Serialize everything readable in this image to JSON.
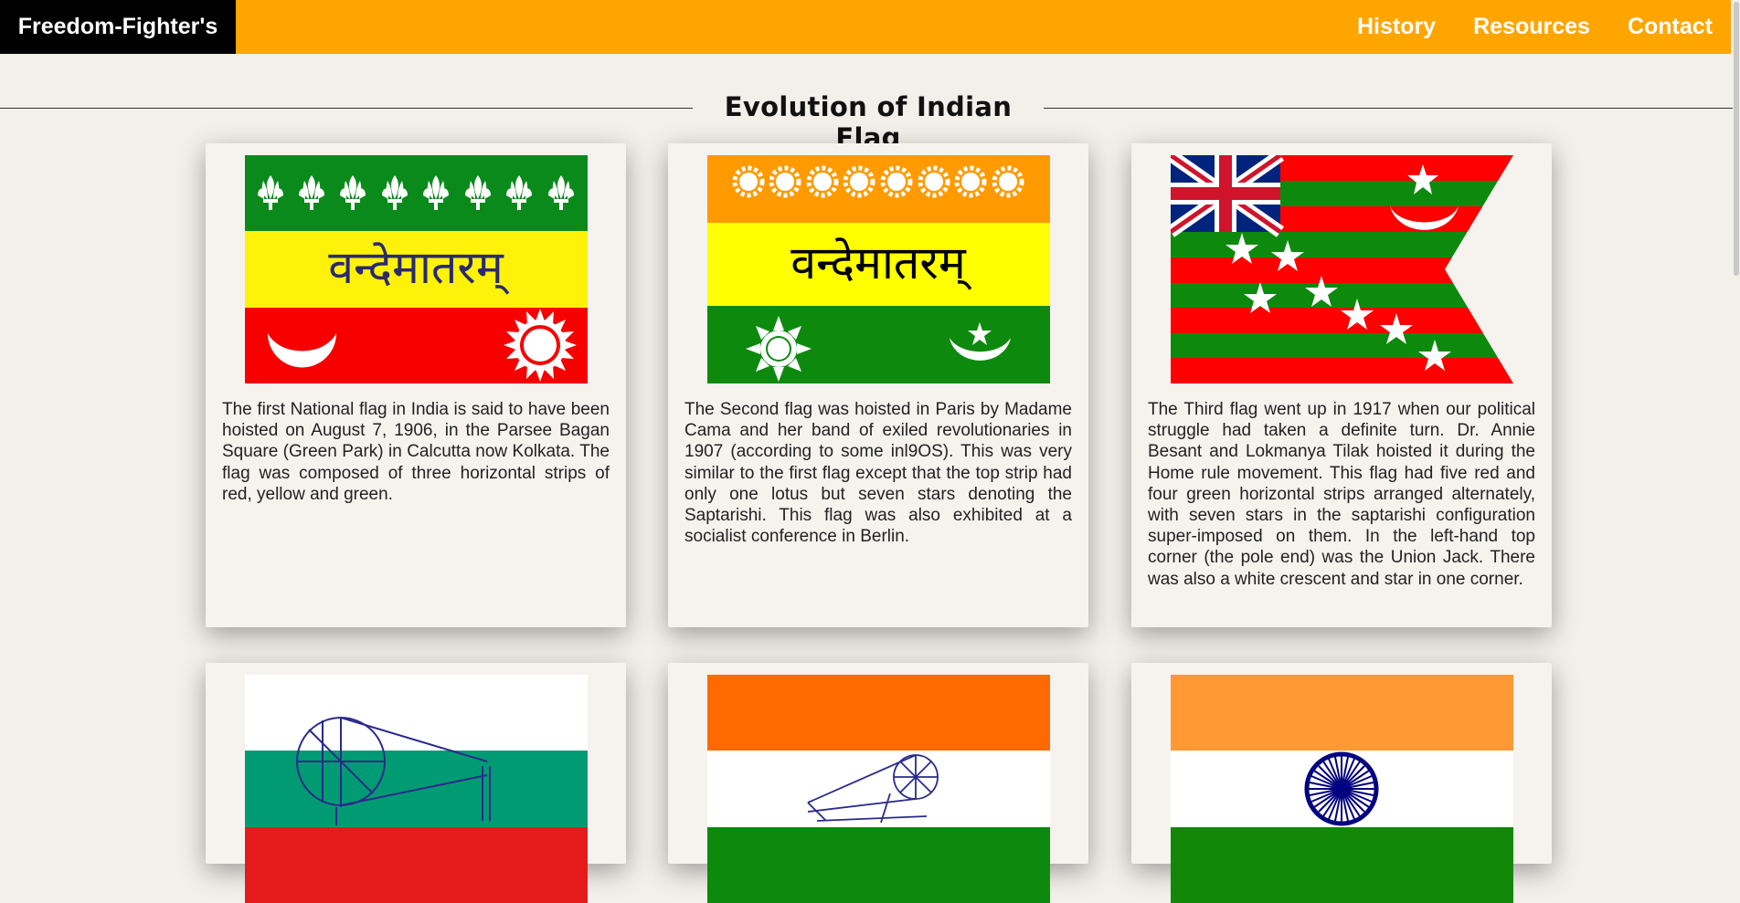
{
  "navbar": {
    "brand": "Freedom-Fighter's",
    "links": [
      "History",
      "Resources",
      "Contact"
    ]
  },
  "section": {
    "title": "Evolution of Indian Flag"
  },
  "cards": [
    {
      "flag_text": "वन्देमातरम्",
      "description": "The first National flag in India is said to have been hoisted on August 7, 1906, in the Parsee Bagan Square (Green Park) in Calcutta now Kolkata. The flag was composed of three horizontal strips of red, yellow and green."
    },
    {
      "flag_text": "वन्देमातरम्",
      "description": "The Second flag was hoisted in Paris by Madame Cama and her band of exiled revolutionaries in 1907 (according to some inl9OS). This was very similar to the first flag except that the top strip had only one lotus but seven stars denoting the Saptarishi. This flag was also exhibited at a socialist conference in Berlin."
    },
    {
      "description": "The Third flag went up in 1917 when our political struggle had taken a definite turn. Dr. Annie Besant and Lokmanya Tilak hoisted it during the Home rule movement. This flag had five red and four green horizontal strips arranged alternately, with seven stars in the saptarishi configuration super-imposed on them. In the left-hand top corner (the pole end) was the Union Jack. There was also a white crescent and star in one corner."
    }
  ],
  "colors": {
    "navbar": "#ffa500",
    "brand_bg": "#000000",
    "page_bg": "#f3efeb",
    "card_bg": "#f6f3ef"
  }
}
